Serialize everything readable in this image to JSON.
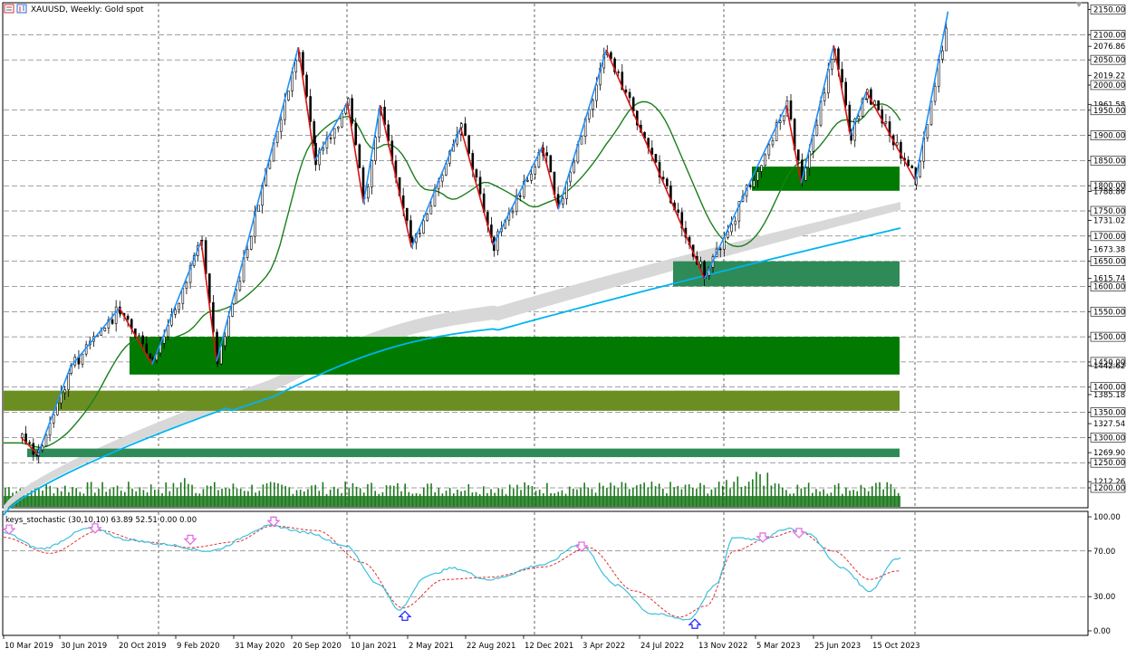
{
  "window": {
    "symbol": "XAUUSD",
    "timeframe": "Weekly",
    "description": "Gold spot",
    "title": "XAUUSD, Weekly:  Gold spot"
  },
  "indicator": {
    "label": "keys_stochastic (30,10,10) 63.89 52.51 0.00 0.00",
    "levels": [
      "100.00",
      "70.00",
      "30.00",
      "0.00"
    ]
  },
  "colors": {
    "background": "#ffffff",
    "grid": "#000000",
    "zigzag_up": "#1e90ff",
    "zigzag_down": "#dd1111",
    "ma_green": "#1a7f1a",
    "ma_blue": "#00b4f0",
    "band_grey": "#d8d8d8",
    "zone_dark_green": "#007a00",
    "zone_olive": "#6b8e23",
    "zone_sea_green": "#2e8b57",
    "volume": "#1f7a1f",
    "stoch_main": "#3cc0dc",
    "stoch_signal": "#e03030",
    "arrow_down": "#e070e0",
    "arrow_up": "#3030ff"
  },
  "price_axis": {
    "labels": [
      "2150.00",
      "2100.00",
      "2076.86",
      "2050.00",
      "2019.22",
      "2000.00",
      "1961.58",
      "1950.00",
      "1900.00",
      "1850.00",
      "1800.00",
      "1788.86",
      "1750.00",
      "1731.02",
      "1700.00",
      "1673.38",
      "1650.00",
      "1615.74",
      "1600.00",
      "1550.00",
      "1500.00",
      "1450.00",
      "1442.62",
      "1400.00",
      "1385.18",
      "1350.00",
      "1327.54",
      "1300.00",
      "1269.90",
      "1250.00",
      "1212.26",
      "1200.00"
    ],
    "current_price": "2000.00"
  },
  "time_axis": {
    "labels": [
      "10 Mar 2019",
      "30 Jun 2019",
      "20 Oct 2019",
      "9 Feb 2020",
      "31 May 2020",
      "20 Sep 2020",
      "10 Jan 2021",
      "2 May 2021",
      "22 Aug 2021",
      "12 Dec 2021",
      "3 Apr 2022",
      "24 Jul 2022",
      "13 Nov 2022",
      "5 Mar 2023",
      "25 Jun 2023",
      "15 Oct 2023"
    ]
  },
  "chart_data": {
    "type": "candlestick",
    "title": "XAUUSD, Weekly:  Gold spot",
    "ylim": [
      1200,
      2150
    ],
    "zigzag_pivots": [
      {
        "date": "Mar 2019",
        "price": 1300
      },
      {
        "date": "Apr 2019",
        "price": 1266
      },
      {
        "date": "Jun 2019",
        "price": 1440
      },
      {
        "date": "Sep 2019",
        "price": 1557
      },
      {
        "date": "Nov 2019",
        "price": 1445
      },
      {
        "date": "Feb 2020",
        "price": 1690
      },
      {
        "date": "Mar 2020",
        "price": 1451
      },
      {
        "date": "Aug 2020",
        "price": 2075
      },
      {
        "date": "Sep 2020",
        "price": 1850
      },
      {
        "date": "Nov 2020",
        "price": 1965
      },
      {
        "date": "Dec 2020",
        "price": 1765
      },
      {
        "date": "Jan 2021",
        "price": 1960
      },
      {
        "date": "Mar 2021",
        "price": 1677
      },
      {
        "date": "Jun 2021",
        "price": 1916
      },
      {
        "date": "Aug 2021",
        "price": 1682
      },
      {
        "date": "Nov 2021",
        "price": 1877
      },
      {
        "date": "Dec 2021",
        "price": 1753
      },
      {
        "date": "Mar 2022",
        "price": 2070
      },
      {
        "date": "Sep 2022",
        "price": 1615
      },
      {
        "date": "Feb 2023",
        "price": 1960
      },
      {
        "date": "Mar 2023",
        "price": 1805
      },
      {
        "date": "May 2023",
        "price": 2079
      },
      {
        "date": "Jun 2023",
        "price": 1900
      },
      {
        "date": "Jul 2023",
        "price": 1987
      },
      {
        "date": "Oct 2023",
        "price": 1810
      },
      {
        "date": "Dec 2023",
        "price": 2146
      }
    ],
    "price_zones": [
      {
        "low": 1790,
        "high": 1838,
        "color": "#007a00"
      },
      {
        "low": 1600,
        "high": 1650,
        "color": "#2e8b57"
      },
      {
        "low": 1425,
        "high": 1500,
        "color": "#007a00"
      },
      {
        "low": 1353,
        "high": 1393,
        "color": "#6b8e23"
      },
      {
        "low": 1261,
        "high": 1278,
        "color": "#2e8b57"
      }
    ],
    "stochastic": {
      "params": "(30,10,10)",
      "main_last": 63.89,
      "signal_last": 52.51,
      "ylim": [
        0,
        100
      ]
    }
  }
}
